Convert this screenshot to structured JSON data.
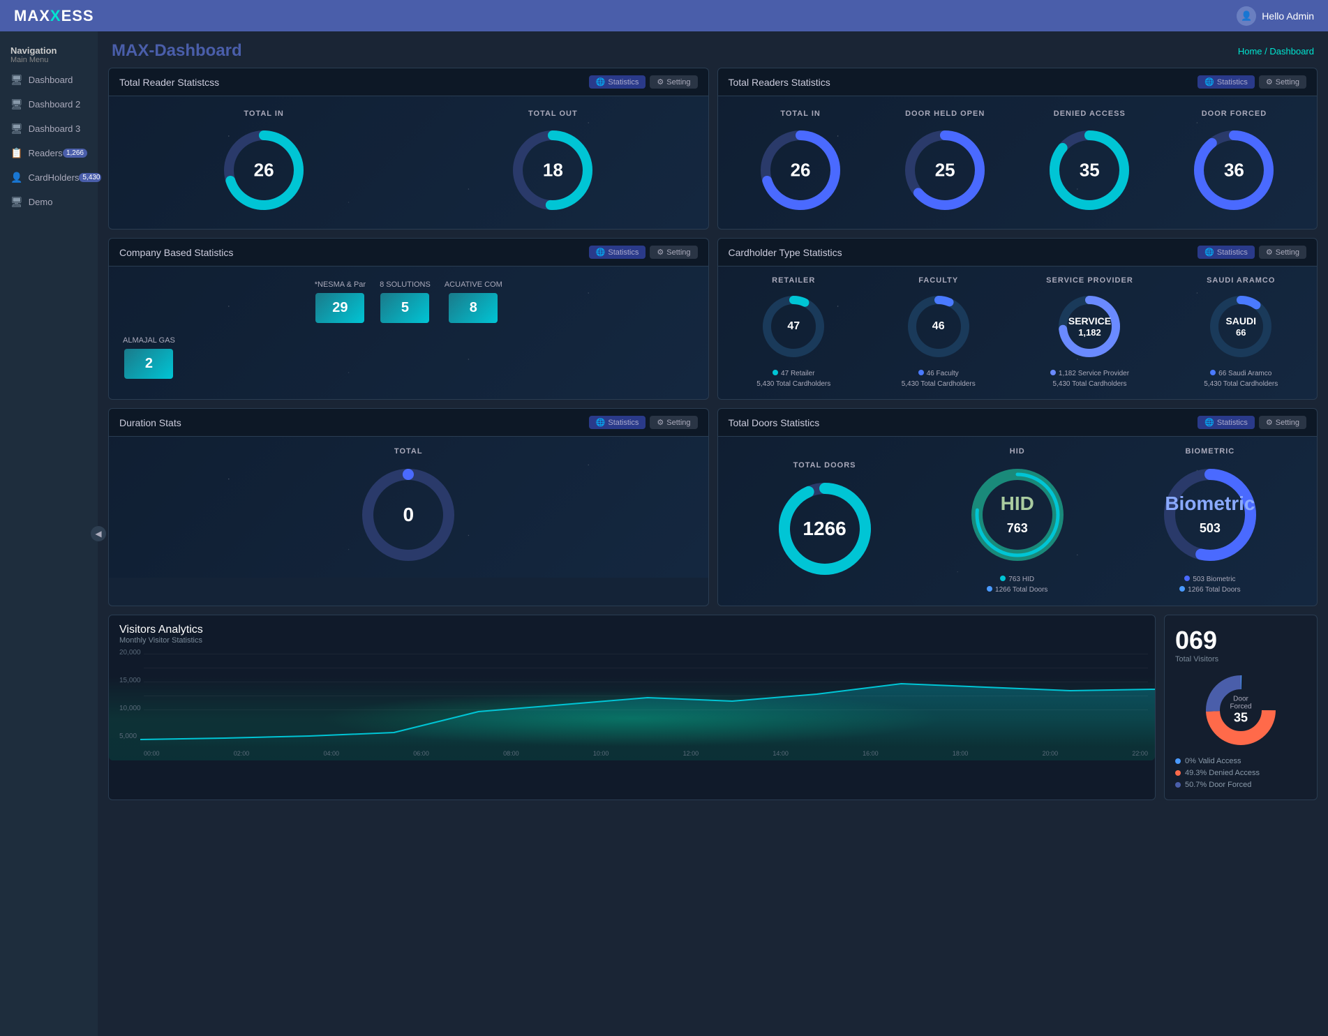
{
  "topbar": {
    "logo": "MAXXESS",
    "logo_accent": "X",
    "user_greeting": "Hello Admin"
  },
  "sidebar": {
    "nav_title": "Navigation",
    "nav_subtitle": "Main Menu",
    "items": [
      {
        "label": "Dashboard",
        "icon": "🖥",
        "badge": null
      },
      {
        "label": "Dashboard 2",
        "icon": "🖥",
        "badge": null
      },
      {
        "label": "Dashboard 3",
        "icon": "🖥",
        "badge": null
      },
      {
        "label": "Readers",
        "icon": "📋",
        "badge": "1,266"
      },
      {
        "label": "CardHolders",
        "icon": "👤",
        "badge": "5,430"
      },
      {
        "label": "Demo",
        "icon": "🖥",
        "badge": null
      }
    ],
    "collapse_icon": "◀"
  },
  "breadcrumb": {
    "home": "Home",
    "separator": "/",
    "current": "Dashboard"
  },
  "dashboard_title_prefix": "MAX-",
  "dashboard_title": "Dashboard",
  "widgets": {
    "total_reader": {
      "title": "Total Reader Statistcss",
      "stats_label": "Statistics",
      "setting_label": "Setting",
      "total_in": {
        "label": "Total In",
        "value": "26"
      },
      "total_out": {
        "label": "Total Out",
        "value": "18"
      }
    },
    "total_readers": {
      "title": "Total Readers Statistics",
      "stats_label": "Statistics",
      "setting_label": "Setting",
      "total_in": {
        "label": "Total In",
        "value": "26"
      },
      "door_held": {
        "label": "Door Held Open",
        "value": "25"
      },
      "denied": {
        "label": "Denied Access",
        "value": "35"
      },
      "door_forced": {
        "label": "Door Forced",
        "value": "36"
      }
    },
    "company": {
      "title": "Company Based Statistics",
      "stats_label": "Statistics",
      "setting_label": "Setting",
      "items": [
        {
          "name": "*NESMA & Par",
          "value": "29"
        },
        {
          "name": "8 SOLUTIONS",
          "value": "5"
        },
        {
          "name": "ACUATIVE COM",
          "value": "8"
        },
        {
          "name": "ALMAJAL GAS",
          "value": "2"
        }
      ]
    },
    "cardholder_type": {
      "title": "Cardholder Type Statistics",
      "stats_label": "Statistics",
      "setting_label": "Setting",
      "items": [
        {
          "label": "Retailer",
          "value": 47,
          "total": 5430,
          "color": "#00c5d5",
          "bg_color": "#1a4a8a"
        },
        {
          "label": "Faculty",
          "value": 46,
          "total": 5430,
          "color": "#4a7aff",
          "bg_color": "#1a2a8a"
        },
        {
          "label": "Service Provider",
          "value": 1182,
          "total": 5430,
          "color": "#6a8aff",
          "bg_color": "#2a3a9a",
          "center_text": "SERVICE"
        },
        {
          "label": "Saudi Aramco",
          "value": 66,
          "total": 5430,
          "color": "#4a7aff",
          "bg_color": "#1a2a8a",
          "center_text": "SAUDI"
        }
      ]
    },
    "duration": {
      "title": "Duration Stats",
      "stats_label": "Statistics",
      "setting_label": "Setting",
      "total_label": "Total",
      "total_value": "0"
    },
    "total_doors": {
      "title": "Total Doors Statistics",
      "stats_label": "Statistics",
      "setting_label": "Setting",
      "total_doors": {
        "label": "Total Doors",
        "value": "1266"
      },
      "hid": {
        "label": "HID",
        "value": "763",
        "total": "1266",
        "legend1": "763 HID",
        "legend2": "1266 Total Doors"
      },
      "biometric": {
        "label": "Biometric",
        "value": "503",
        "total": "1266",
        "legend1": "503 Biometric",
        "legend2": "1266 Total Doors"
      }
    },
    "visitors": {
      "title": "Visitors Analytics",
      "subtitle": "Monthly Visitor Statistics",
      "total_count": "069",
      "total_label": "Total Visitors",
      "pie_center_label": "Door Forced",
      "pie_center_value": "35",
      "chart_y_labels": [
        "20,000",
        "15,000",
        "10,000",
        "5,000",
        ""
      ],
      "chart_x_labels": [
        "00:00",
        "02:00",
        "04:00",
        "06:00",
        "08:00",
        "10:00",
        "12:00",
        "14:00",
        "16:00",
        "18:00",
        "20:00",
        "22:00"
      ],
      "legends": [
        {
          "label": "0% Valid Access",
          "color": "#4a9aff"
        },
        {
          "label": "49.3% Denied Access",
          "color": "#ff6a6a"
        },
        {
          "label": "50.7% Door Forced",
          "color": "#4a5eaa"
        }
      ],
      "pie_segments": [
        {
          "label": "Valid Access",
          "percent": 0,
          "color": "#4a9aff"
        },
        {
          "label": "Denied Access",
          "percent": 49.3,
          "color": "#ff6a4a"
        },
        {
          "label": "Door Forced",
          "percent": 50.7,
          "color": "#4a5eaa"
        }
      ]
    }
  }
}
